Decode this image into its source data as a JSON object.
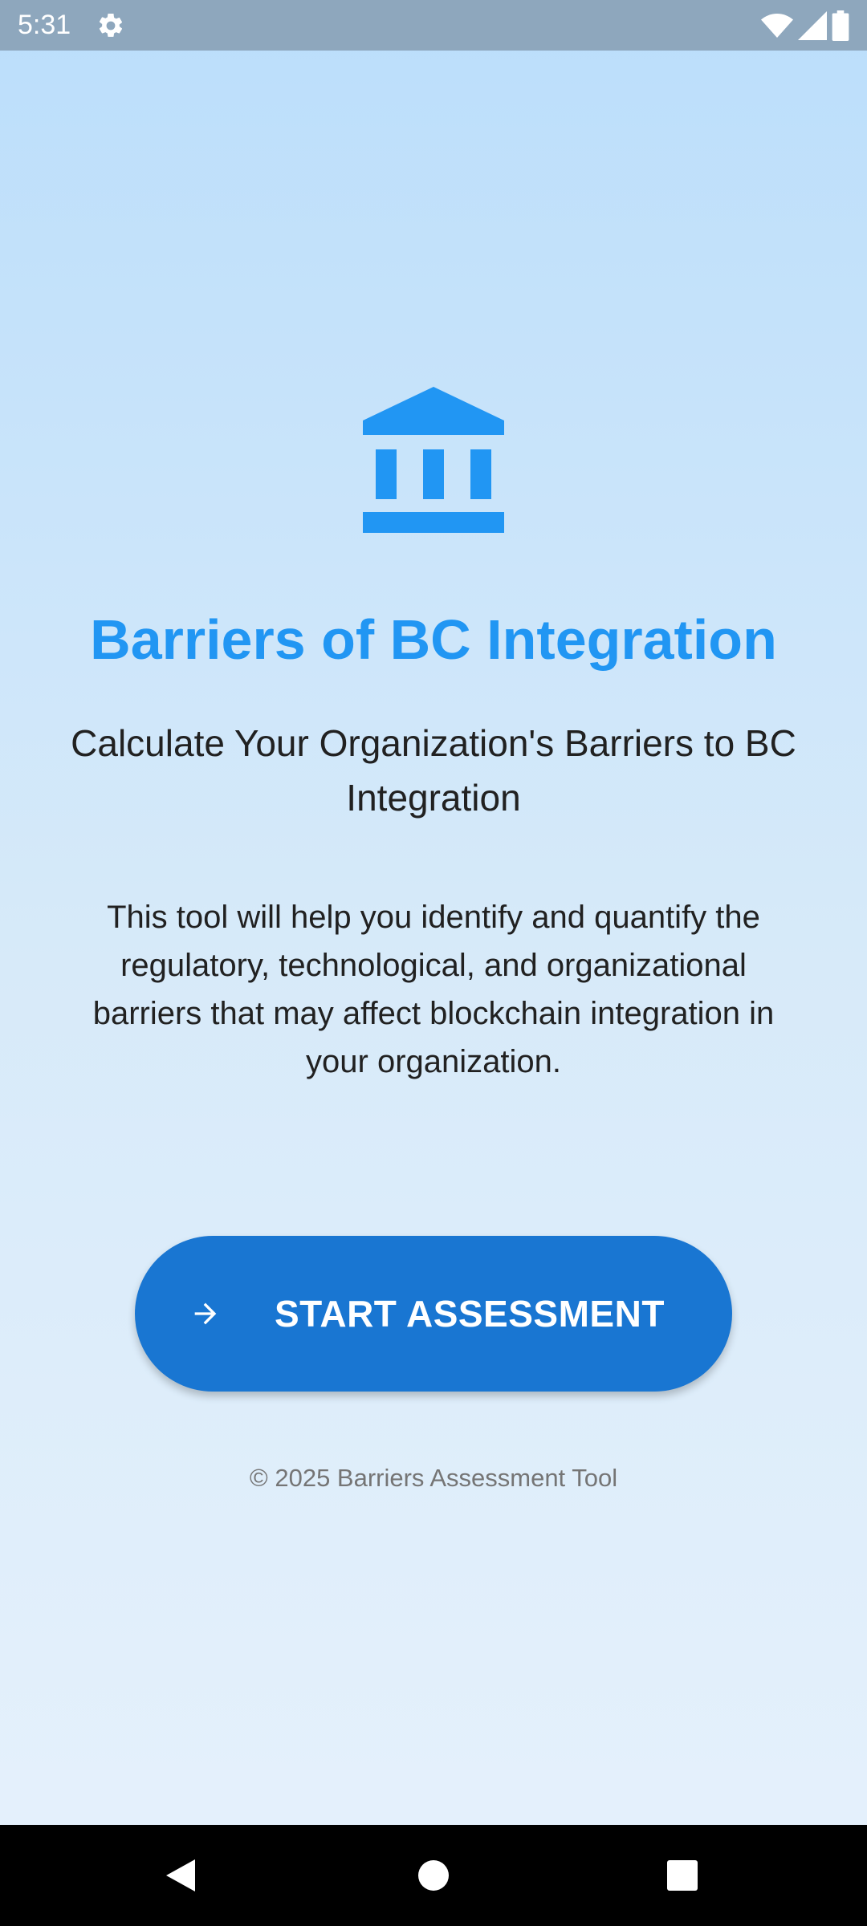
{
  "status_bar": {
    "time": "5:31",
    "icons": [
      "settings-gear-icon",
      "wifi-icon",
      "cellular-signal-icon",
      "battery-icon"
    ]
  },
  "main": {
    "icon": "bank-building-icon",
    "title": "Barriers of BC Integration",
    "subtitle": "Calculate Your Organization's Barriers to BC Integration",
    "description": "This tool will help you identify and quantify the regulatory, technological, and organizational barriers that may affect blockchain integration in your organization.",
    "start_button": {
      "label": "START ASSESSMENT",
      "icon": "arrow-forward-icon"
    },
    "footer": "© 2025 Barriers Assessment Tool"
  },
  "nav_bar": {
    "buttons": [
      "back-icon",
      "home-icon",
      "recent-apps-icon"
    ]
  },
  "colors": {
    "accent": "#2196f3",
    "button": "#1976d2",
    "status_bar": "#8ea7bd",
    "background_top": "#bbdefb",
    "background_bottom": "#e6f1fc"
  }
}
